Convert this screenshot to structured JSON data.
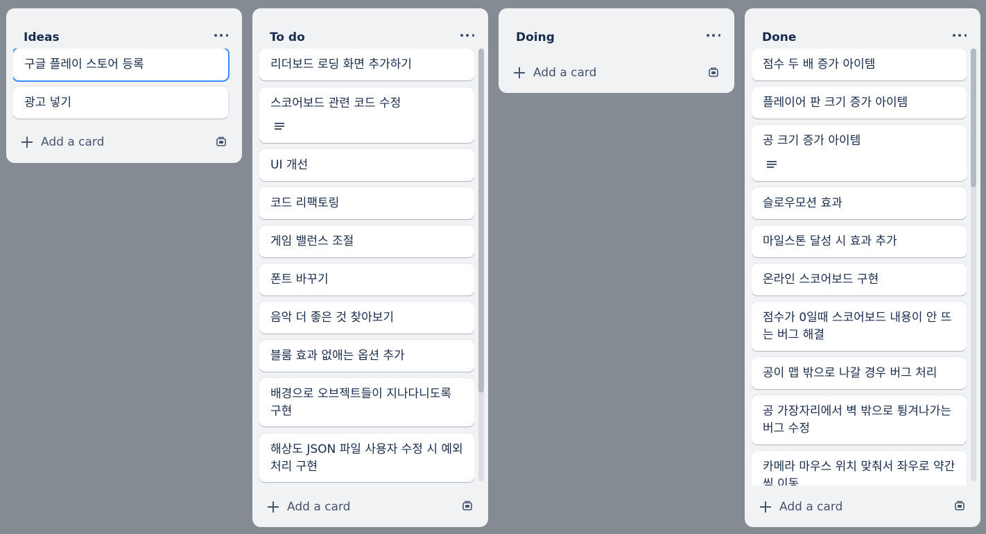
{
  "lists": [
    {
      "title": "Ideas",
      "cards": [
        "구글 플레이 스토어 등록",
        "광고 넣기"
      ],
      "add_card_label": "Add a card"
    },
    {
      "title": "To do",
      "cards": [
        "리더보드 로딩 화면 추가하기",
        "스코어보드 관련 코드 수정",
        "UI 개선",
        "코드 리팩토링",
        "게임 밸런스 조절",
        "폰트 바꾸기",
        "음악 더 좋은 것 찾아보기",
        "블룸 효과 없애는 옵션 추가",
        "배경으로 오브젝트들이 지나다니도록 구현",
        "해상도 JSON 파일 사용자 수정 시 예외 처리 구현"
      ],
      "add_card_label": "Add a card"
    },
    {
      "title": "Doing",
      "cards": [],
      "add_card_label": "Add a card"
    },
    {
      "title": "Done",
      "cards": [
        "점수 두 배 증가 아이템",
        "플레이어 판 크기 증가 아이템",
        "공 크기 증가 아이템",
        "슬로우모션 효과",
        "마일스톤 달성 시 효과 추가",
        "온라인 스코어보드 구현",
        "점수가 0일때 스코어보드 내용이 안 뜨는 버그 해결",
        "공이 맵 밖으로 나갈 경우 버그 처리",
        "공 가장자리에서 벽 밖으로 튕겨나가는 버그 수정",
        "카메라 마우스 위치 맞춰서 좌우로 약간씩 이동"
      ],
      "add_card_label": "Add a card"
    }
  ],
  "icons": {
    "list_menu": "more-horizontal-icon",
    "add": "plus-icon",
    "template": "card-template-icon",
    "description": "description-icon"
  },
  "colors": {
    "board_background": "#848b92",
    "list_background": "#f1f2f4",
    "card_background": "#ffffff",
    "selected_outline": "#388bff",
    "text": "#172b4d"
  }
}
